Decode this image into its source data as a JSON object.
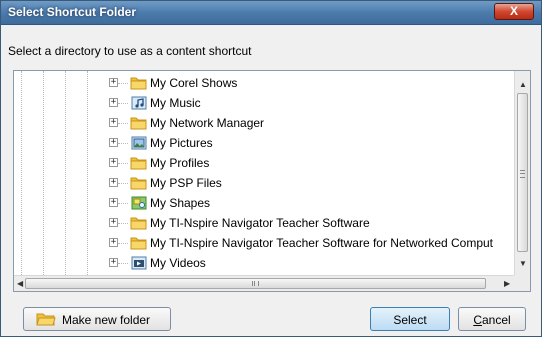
{
  "window": {
    "title": "Select Shortcut Folder",
    "close_label": "X",
    "instruction": "Select a directory to use as a content shortcut"
  },
  "tree": {
    "items": [
      {
        "label": "My Corel Shows",
        "icon": "folder-icon",
        "expander": "+"
      },
      {
        "label": "My Music",
        "icon": "music-folder-icon",
        "expander": "+"
      },
      {
        "label": "My Network Manager",
        "icon": "folder-icon",
        "expander": "+"
      },
      {
        "label": "My Pictures",
        "icon": "pictures-folder-icon",
        "expander": "+"
      },
      {
        "label": "My Profiles",
        "icon": "folder-icon",
        "expander": "+"
      },
      {
        "label": "My PSP Files",
        "icon": "folder-icon",
        "expander": "+"
      },
      {
        "label": "My Shapes",
        "icon": "shapes-folder-icon",
        "expander": "+"
      },
      {
        "label": "My TI-Nspire Navigator Teacher Software",
        "icon": "folder-icon",
        "expander": "+"
      },
      {
        "label": "My TI-Nspire Navigator Teacher Software for Networked Comput",
        "icon": "folder-icon",
        "expander": "+"
      },
      {
        "label": "My Videos",
        "icon": "videos-folder-icon",
        "expander": "+"
      }
    ]
  },
  "buttons": {
    "make_new_folder": "Make new folder",
    "select": "Select",
    "cancel": "Cancel"
  },
  "colors": {
    "titlebar": "#4a79aa",
    "close": "#d0482f",
    "folder": "#f0c13a",
    "primary_button": "#bcdcf4"
  }
}
